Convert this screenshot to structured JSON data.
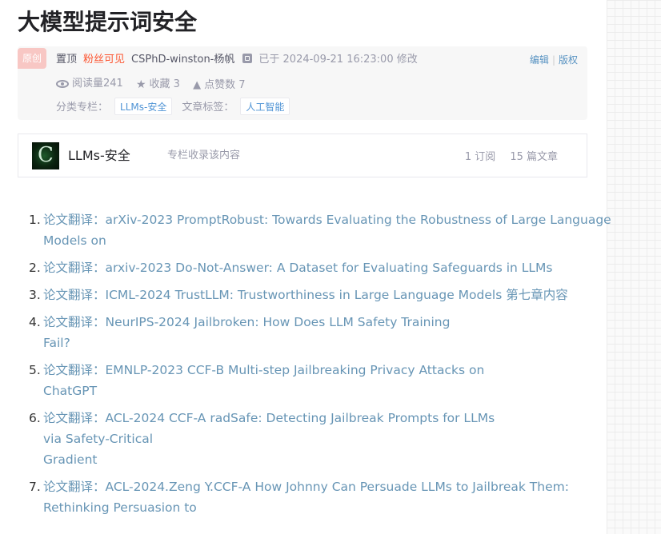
{
  "article": {
    "title": "大模型提示词安全"
  },
  "meta": {
    "badge": "原创",
    "pinned": "置顶",
    "fans_only": "粉丝可见",
    "author": "CSPhD-winston-杨帆",
    "date": "已于 2024-09-21 16:23:00 修改",
    "edit_label": "编辑",
    "copyright_label": "版权",
    "views": "阅读量241",
    "favorites": "收藏 3",
    "likes": "点赞数 7",
    "category_label": "分类专栏：",
    "category_tag": "LLMs-安全",
    "article_tag_label": "文章标签：",
    "article_tag": "人工智能"
  },
  "column": {
    "name": "LLMs-安全",
    "note": "专栏收录该内容",
    "subscriptions": "1 订阅",
    "article_count": "15 篇文章"
  },
  "articles": [
    {
      "num": "1.",
      "lines": [
        "论文翻译：arXiv-2023 PromptRobust: Towards Evaluating the Robustness of Large Language",
        "Models on"
      ]
    },
    {
      "num": "2.",
      "lines": [
        "论文翻译：arxiv-2023 Do-Not-Answer: A Dataset for Evaluating Safeguards in LLMs"
      ]
    },
    {
      "num": "3.",
      "lines": [
        "论文翻译：ICML-2024 TrustLLM: Trustworthiness in Large Language Models 第七章内容"
      ]
    },
    {
      "num": "4.",
      "lines": [
        "论文翻译：NeurIPS-2024 Jailbroken: How Does LLM Safety Training",
        "Fail?"
      ]
    },
    {
      "num": "5.",
      "lines": [
        "论文翻译：EMNLP-2023 CCF-B Multi-step Jailbreaking Privacy Attacks on",
        "ChatGPT"
      ]
    },
    {
      "num": "6.",
      "lines": [
        "论文翻译：ACL-2024 CCF-A radSafe: Detecting Jailbreak Prompts for LLMs",
        "via Safety-Critical",
        "Gradient"
      ]
    },
    {
      "num": "7.",
      "lines": [
        "论文翻译：ACL-2024.Zeng Y.CCF-A How Johnny Can Persuade LLMs to Jailbreak Them:",
        "Rethinking Persuasion to"
      ]
    }
  ]
}
